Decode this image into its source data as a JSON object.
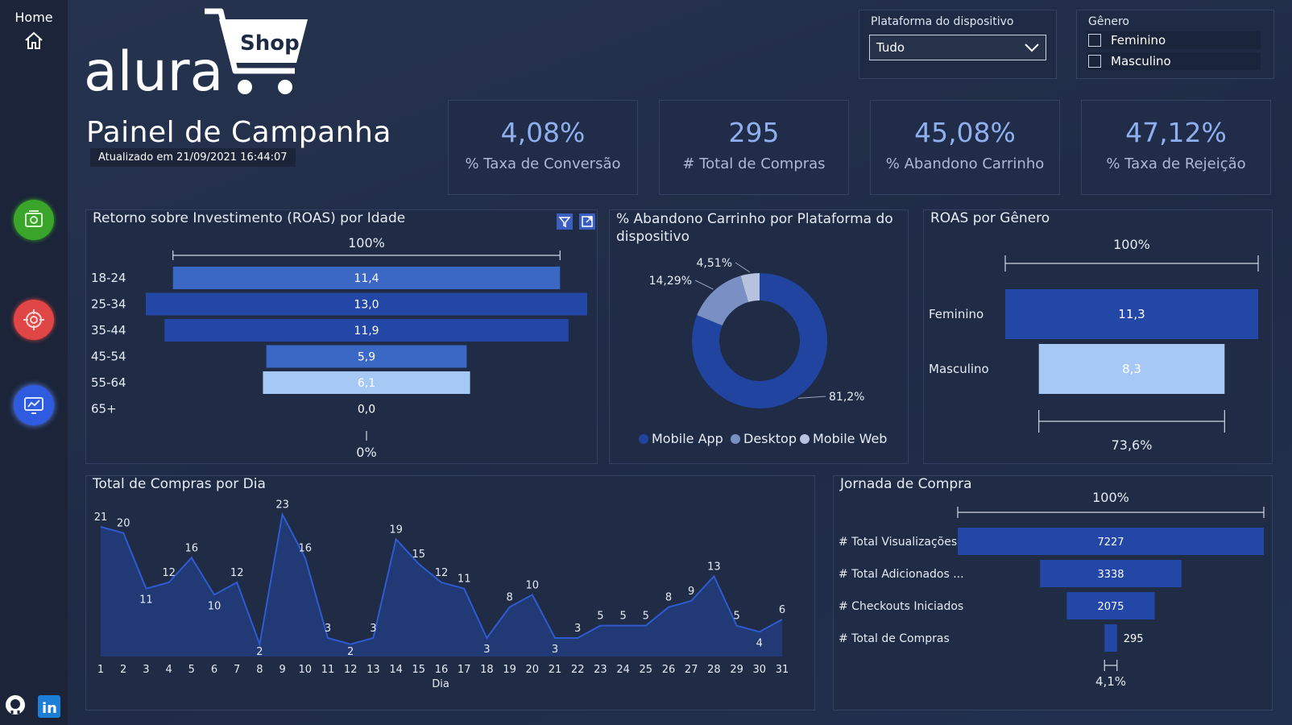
{
  "sidebar": {
    "home_label": "Home"
  },
  "header": {
    "logo_word": "alura",
    "logo_shop": "Shop",
    "title": "Painel de Campanha",
    "updated": "Atualizado em 21/09/2021 16:44:07"
  },
  "slicers": {
    "platform": {
      "title": "Plataforma do dispositivo",
      "value": "Tudo"
    },
    "gender": {
      "title": "Gênero",
      "options": [
        "Feminino",
        "Masculino"
      ]
    }
  },
  "kpis": [
    {
      "value": "4,08%",
      "label": "% Taxa de Conversão"
    },
    {
      "value": "295",
      "label": "# Total de Compras"
    },
    {
      "value": "45,08%",
      "label": "% Abandono Carrinho"
    },
    {
      "value": "47,12%",
      "label": "% Taxa de Rejeição"
    }
  ],
  "colors": {
    "dark_blue": "#2347a6",
    "mid_blue": "#3b68c4",
    "light_blue": "#a6c8f5",
    "pie_dark": "#2144a0",
    "pie_mid": "#7a90c4",
    "pie_light": "#b7c3de"
  },
  "chart_data": [
    {
      "type": "bar",
      "title": "Retorno sobre Investimento (ROAS) por Idade",
      "categories": [
        "18-24",
        "25-34",
        "35-44",
        "45-54",
        "55-64",
        "65+"
      ],
      "values": [
        11.4,
        13.0,
        11.9,
        5.9,
        6.1,
        0.0
      ],
      "value_labels": [
        "11,4",
        "13,0",
        "11,9",
        "5,9",
        "6,1",
        "0,0"
      ],
      "top_label": "100%",
      "bottom_label": "0%"
    },
    {
      "type": "pie",
      "title": "% Abandono Carrinho por Plataforma do dispositivo",
      "labels": [
        "Mobile App",
        "Desktop",
        "Mobile Web"
      ],
      "values": [
        81.2,
        14.29,
        4.51
      ],
      "value_labels": [
        "81,2%",
        "14,29%",
        "4,51%"
      ]
    },
    {
      "type": "bar",
      "title": "ROAS por Gênero",
      "categories": [
        "Feminino",
        "Masculino"
      ],
      "values": [
        11.3,
        8.3
      ],
      "value_labels": [
        "11,3",
        "8,3"
      ],
      "top_label": "100%",
      "bottom_label": "73,6%"
    },
    {
      "type": "area",
      "title": "Total de Compras por Dia",
      "xlabel": "Dia",
      "x": [
        1,
        2,
        3,
        4,
        5,
        6,
        7,
        8,
        9,
        10,
        11,
        12,
        13,
        14,
        15,
        16,
        17,
        18,
        19,
        20,
        21,
        22,
        23,
        24,
        25,
        26,
        27,
        28,
        29,
        30,
        31
      ],
      "values": [
        21,
        20,
        11,
        12,
        16,
        10,
        12,
        2,
        23,
        16,
        3,
        2,
        3,
        19,
        15,
        12,
        11,
        3,
        8,
        10,
        3,
        3,
        5,
        5,
        5,
        8,
        9,
        13,
        5,
        4,
        6
      ],
      "ylim": [
        0,
        24
      ]
    },
    {
      "type": "bar",
      "title": "Jornada de Compra",
      "categories": [
        "# Total Visualizações",
        "# Total Adicionados ...",
        "# Checkouts Iniciados",
        "# Total de Compras"
      ],
      "values": [
        7227,
        3338,
        2075,
        295
      ],
      "top_label": "100%",
      "bottom_label": "4,1%"
    }
  ]
}
